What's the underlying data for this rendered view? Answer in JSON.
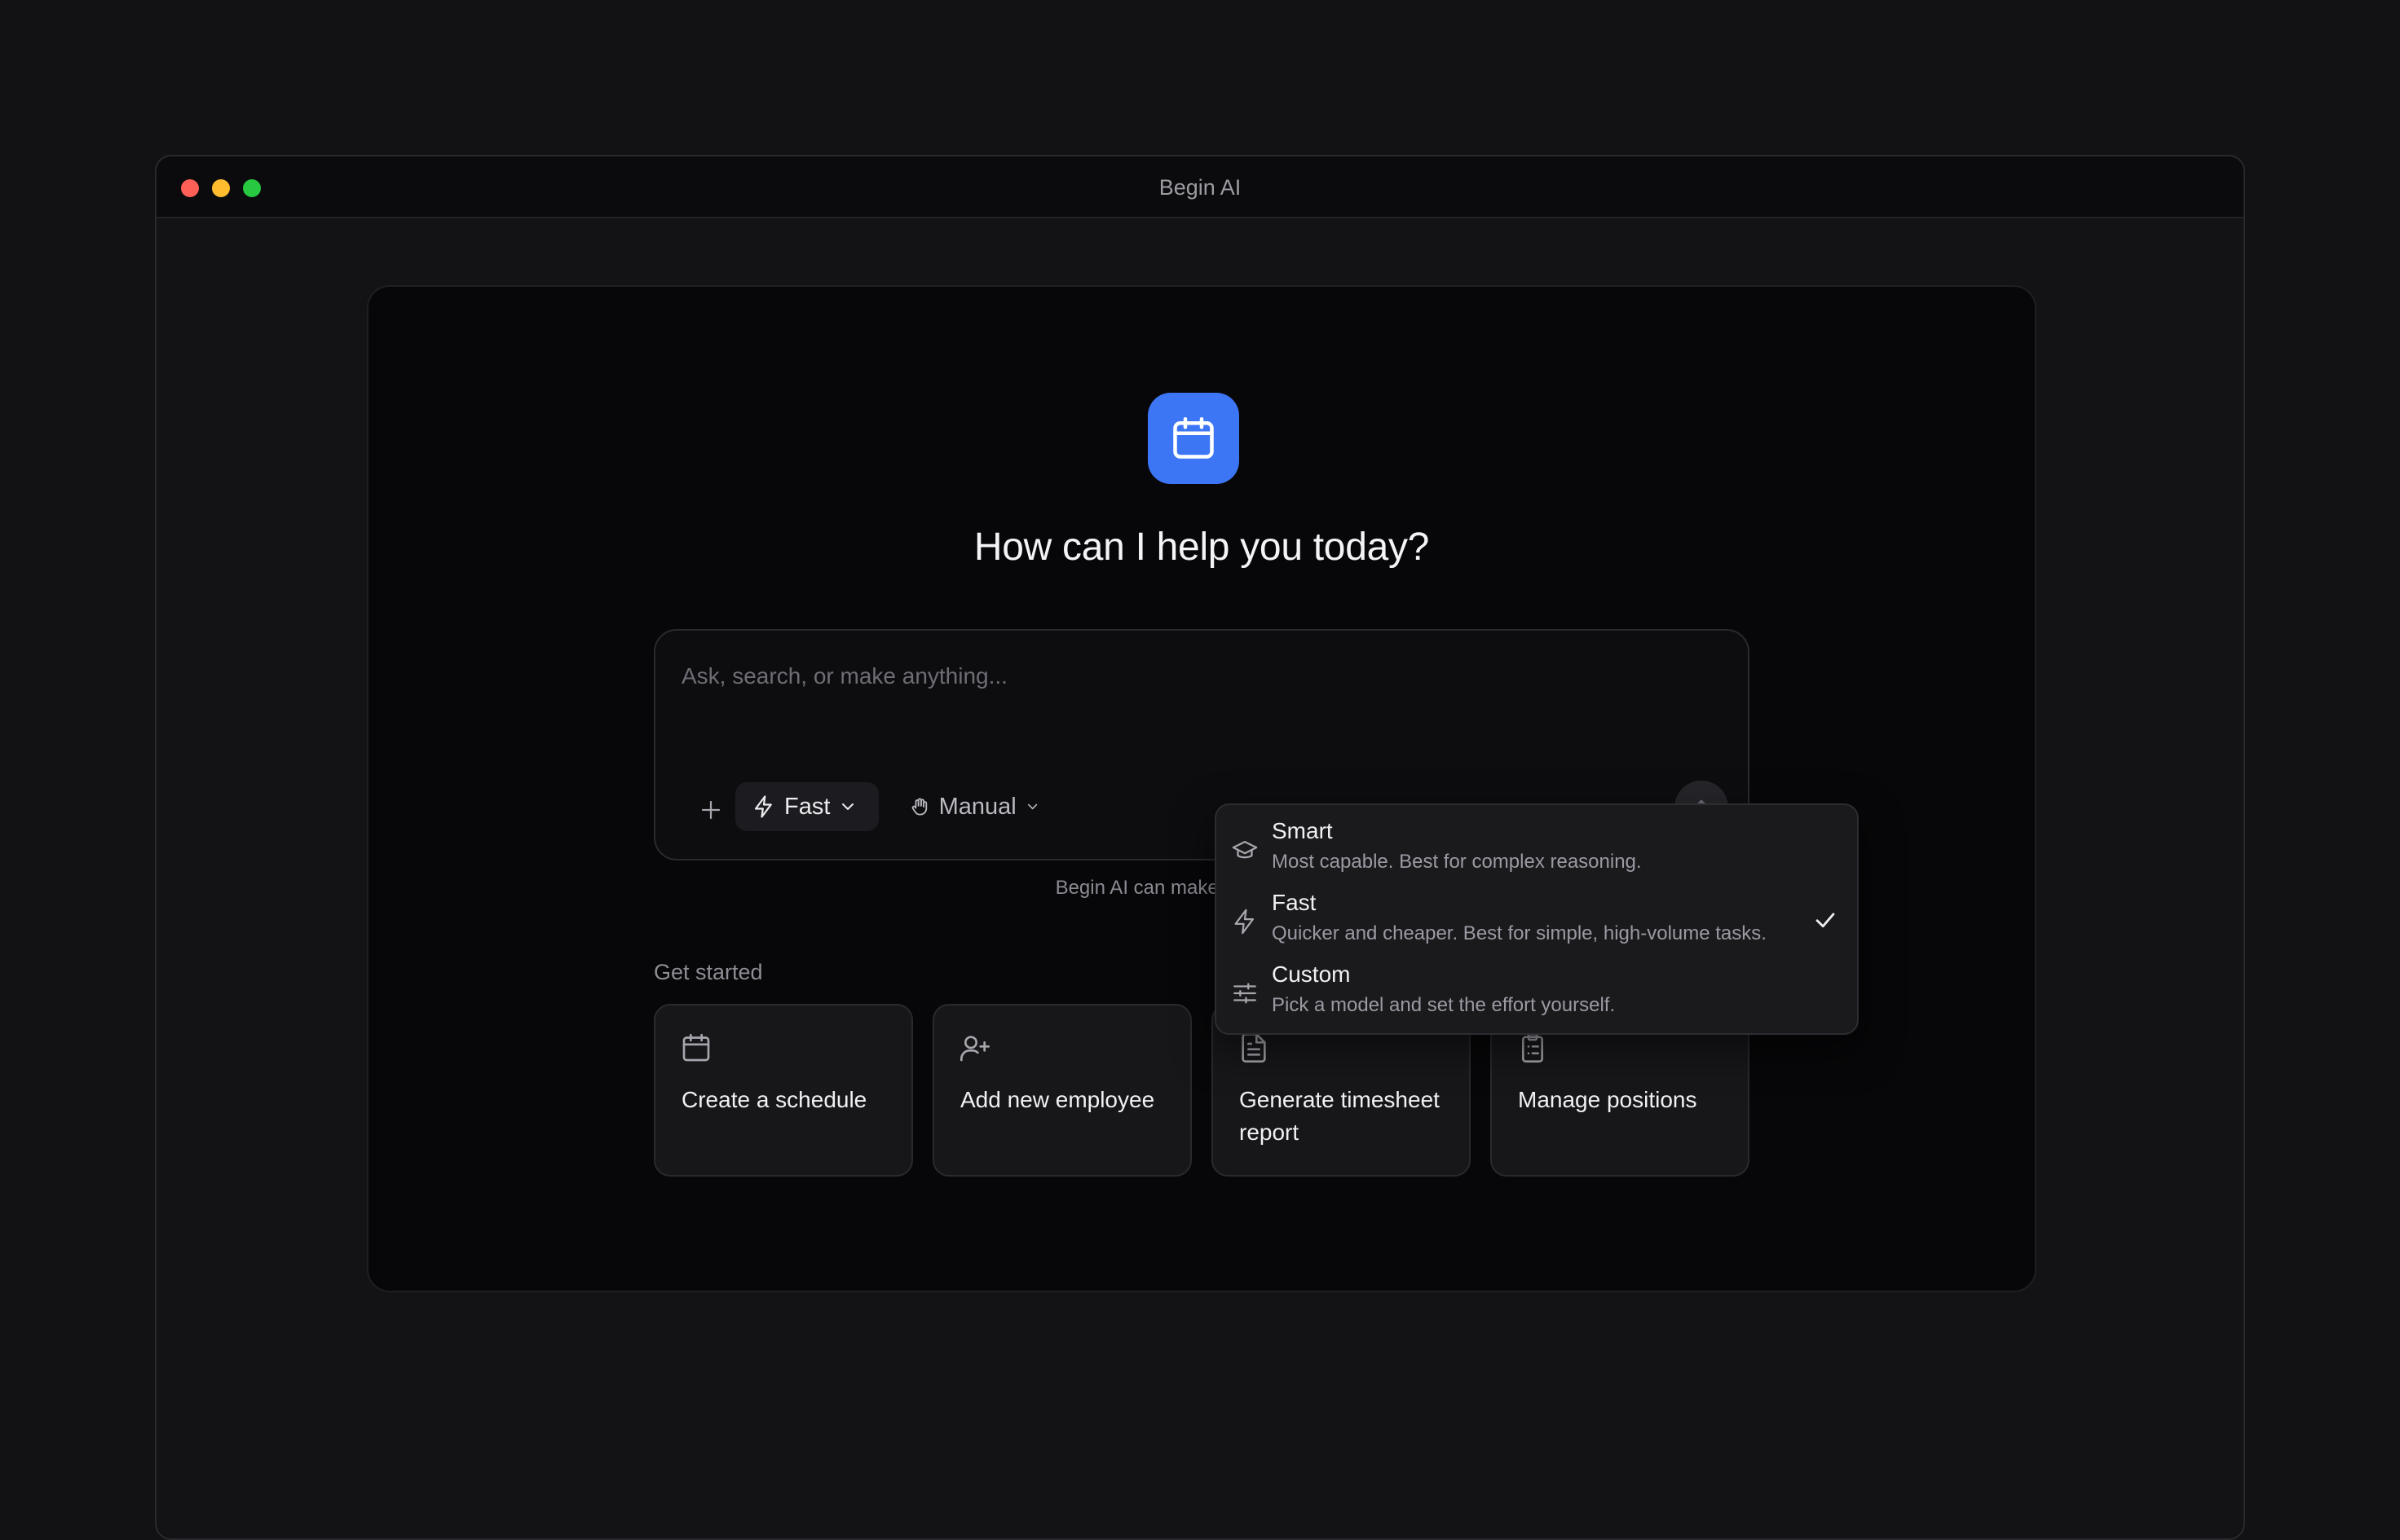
{
  "window": {
    "title": "Begin AI"
  },
  "main": {
    "heading": "How can I help you today?",
    "composer": {
      "placeholder": "Ask, search, or make anything...",
      "model_chip": "Fast",
      "mode_chip": "Manual"
    },
    "disclaimer": "Begin AI can make mistakes. Dou",
    "get_started_label": "Get started",
    "quick_actions": [
      {
        "label": "Create a schedule",
        "icon": "calendar-icon"
      },
      {
        "label": "Add new employee",
        "icon": "user-plus-icon"
      },
      {
        "label": "Generate timesheet report",
        "icon": "document-icon"
      },
      {
        "label": "Manage positions",
        "icon": "clipboard-icon"
      }
    ]
  },
  "model_dropdown": {
    "selected": "Fast",
    "options": [
      {
        "title": "Smart",
        "description": "Most capable. Best for complex reasoning.",
        "icon": "graduation-cap-icon"
      },
      {
        "title": "Fast",
        "description": "Quicker and cheaper. Best for simple, high-volume tasks.",
        "icon": "lightning-icon"
      },
      {
        "title": "Custom",
        "description": "Pick a model and set the effort yourself.",
        "icon": "sliders-icon"
      }
    ]
  },
  "colors": {
    "accent": "#3d76f4",
    "background": "#121214",
    "card": "#070709",
    "surface": "#17171a"
  }
}
